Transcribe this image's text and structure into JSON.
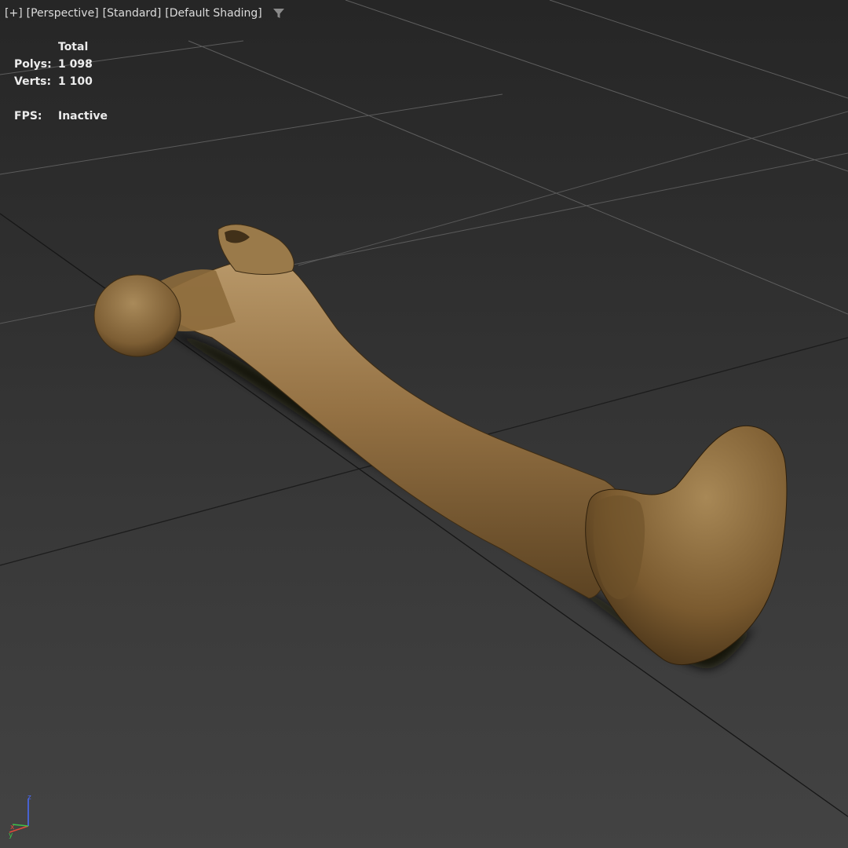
{
  "viewport": {
    "labels": [
      "[+]",
      "[Perspective]",
      "[Standard]",
      "[Default Shading]"
    ],
    "filter_icon": "filter-funnel-icon"
  },
  "stats": {
    "header": "Total",
    "polys_label": "Polys:",
    "polys_value": "1 098",
    "verts_label": "Verts:",
    "verts_value": "1 100",
    "fps_label": "FPS:",
    "fps_value": "Inactive"
  },
  "axis_tripod": {
    "z": "z",
    "x": "x",
    "y": "y"
  },
  "colors": {
    "background": "#333333",
    "grid_line": "#6a6a6a",
    "grid_axis_line": "#111111",
    "bone": "#8c6c3f",
    "label_text": "#dcdcdc",
    "axis_z": "#4a6cff",
    "axis_x": "#e04a3a",
    "axis_y": "#3ec24a"
  },
  "object": {
    "name": "bone-model"
  }
}
